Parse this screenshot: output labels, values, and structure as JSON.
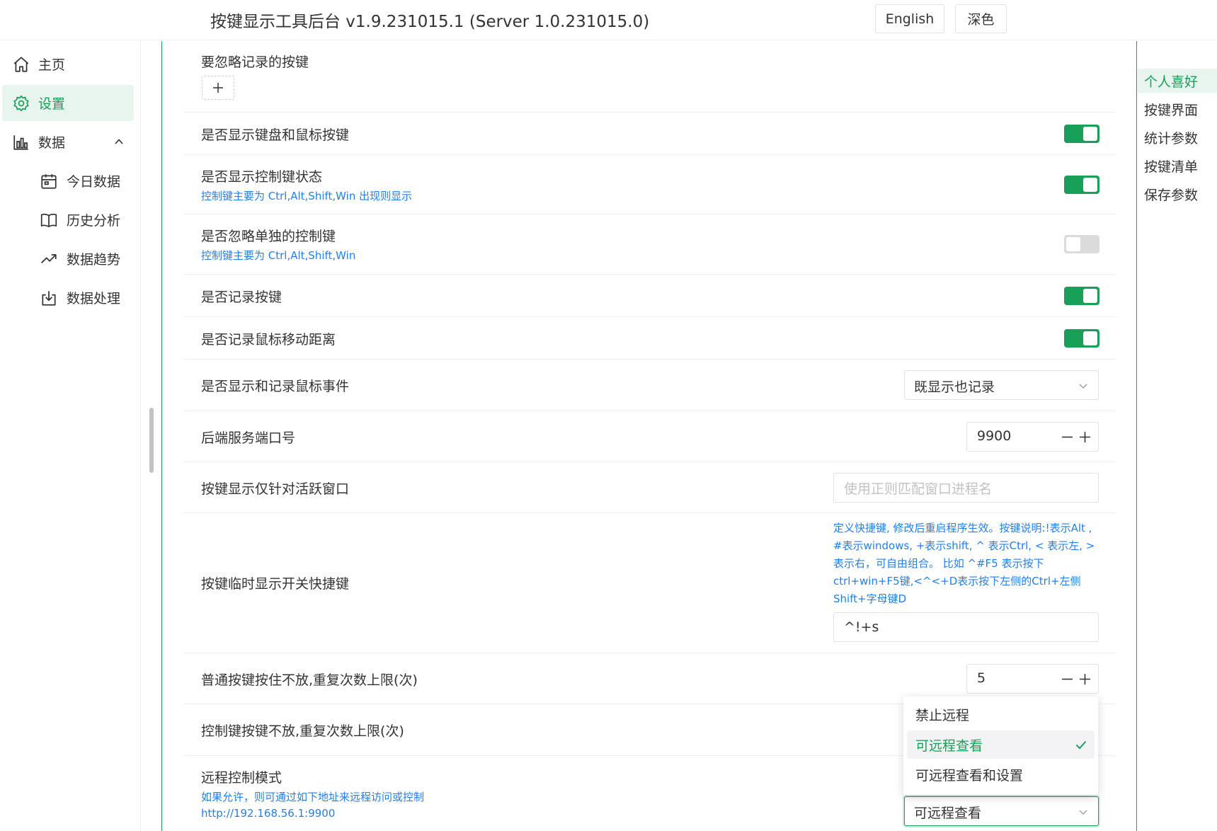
{
  "header": {
    "title": "按键显示工具后台 v1.9.231015.1 (Server 1.0.231015.0)",
    "lang_button": "English",
    "theme_button": "深色"
  },
  "sidebar": {
    "items": [
      {
        "label": "主页",
        "icon": "home-icon"
      },
      {
        "label": "设置",
        "icon": "gear-icon",
        "active": true
      },
      {
        "label": "数据",
        "icon": "bar-chart-icon",
        "expanded": true
      },
      {
        "label": "今日数据",
        "icon": "calendar-icon"
      },
      {
        "label": "历史分析",
        "icon": "book-icon"
      },
      {
        "label": "数据趋势",
        "icon": "trend-icon"
      },
      {
        "label": "数据处理",
        "icon": "download-icon"
      }
    ]
  },
  "settings": {
    "ignore_keys": {
      "label": "要忽略记录的按键"
    },
    "show_kbd_mouse": {
      "label": "是否显示键盘和鼠标按键",
      "value": true
    },
    "show_ctrl_state": {
      "label": "是否显示控制键状态",
      "hint": "控制键主要为 Ctrl,Alt,Shift,Win 出现则显示",
      "value": true
    },
    "ignore_single_ctrl": {
      "label": "是否忽略单独的控制键",
      "hint": "控制键主要为 Ctrl,Alt,Shift,Win",
      "value": false
    },
    "record_keys": {
      "label": "是否记录按键",
      "value": true
    },
    "record_mouse_dist": {
      "label": "是否记录鼠标移动距离",
      "value": true
    },
    "mouse_events": {
      "label": "是否显示和记录鼠标事件",
      "value": "既显示也记录"
    },
    "server_port": {
      "label": "后端服务端口号",
      "value": "9900"
    },
    "active_window": {
      "label": "按键显示仅针对活跃窗口",
      "placeholder": "使用正则匹配窗口进程名"
    },
    "hotkey": {
      "label": "按键临时显示开关快捷键",
      "desc": [
        "定义快捷键, 修改后重启程序生效。按键说明:!表示Alt ,",
        "#表示windows, +表示shift, ^ 表示Ctrl, < 表示左, >",
        "表示右，可自由组合。 比如 ^#F5 表示按下",
        "ctrl+win+F5键,<^<+D表示按下左侧的Ctrl+左侧",
        "Shift+字母键D"
      ],
      "value": "^!+s"
    },
    "repeat_normal": {
      "label": "普通按键按住不放,重复次数上限(次)",
      "value": "5"
    },
    "repeat_ctrl": {
      "label": "控制键按键不放,重复次数上限(次)"
    },
    "remote": {
      "label": "远程控制模式",
      "hint": "如果允许，则可通过如下地址来远程访问或控制",
      "url": "http://192.168.56.1:9900",
      "value": "可远程查看"
    }
  },
  "dropdown": {
    "options": [
      "禁止远程",
      "可远程查看",
      "可远程查看和设置"
    ],
    "selected": "可远程查看"
  },
  "anchor": {
    "items": [
      "个人喜好",
      "按键界面",
      "统计参数",
      "按键清单",
      "保存参数"
    ],
    "active": "个人喜好"
  },
  "colors": {
    "accent": "#18a058",
    "hint": "#2080f0",
    "warning": "#e32b2b"
  }
}
